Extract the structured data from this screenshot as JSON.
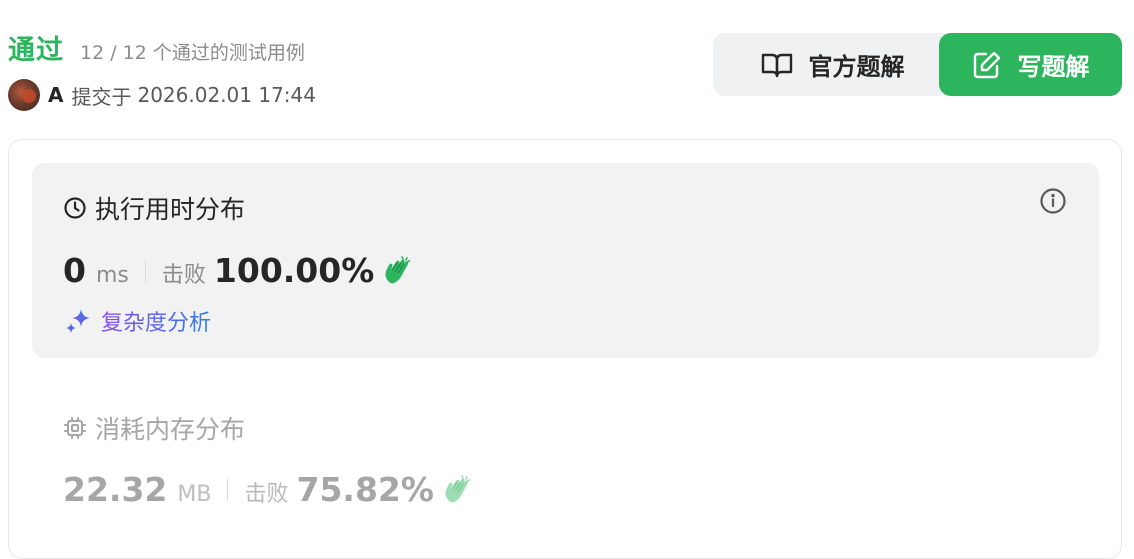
{
  "status": {
    "title": "通过",
    "detail": "12 / 12 个通过的测试用例"
  },
  "submission": {
    "user": "A",
    "label": "提交于",
    "time": "2026.02.01 17:44"
  },
  "actions": {
    "solution_label": "官方题解",
    "write_label": "写题解"
  },
  "runtime": {
    "title": "执行用时分布",
    "value": "0",
    "unit": "ms",
    "beats_label": "击败",
    "beats_value": "100.00%",
    "analysis_label": "复杂度分析"
  },
  "memory": {
    "title": "消耗内存分布",
    "value": "22.32",
    "unit": "MB",
    "beats_label": "击败",
    "beats_value": "75.82%"
  },
  "colors": {
    "accent_green": "#2db55d",
    "muted_text": "#8c8c8c",
    "panel_bg": "#f2f2f3"
  },
  "icons": {
    "avatar": "user-avatar",
    "solution": "book-open-icon",
    "write": "edit-pen-icon",
    "runtime": "clock-icon",
    "info": "info-icon",
    "clap": "clapping-hands-icon",
    "analysis": "sparkle-icon",
    "memory": "chip-icon"
  }
}
